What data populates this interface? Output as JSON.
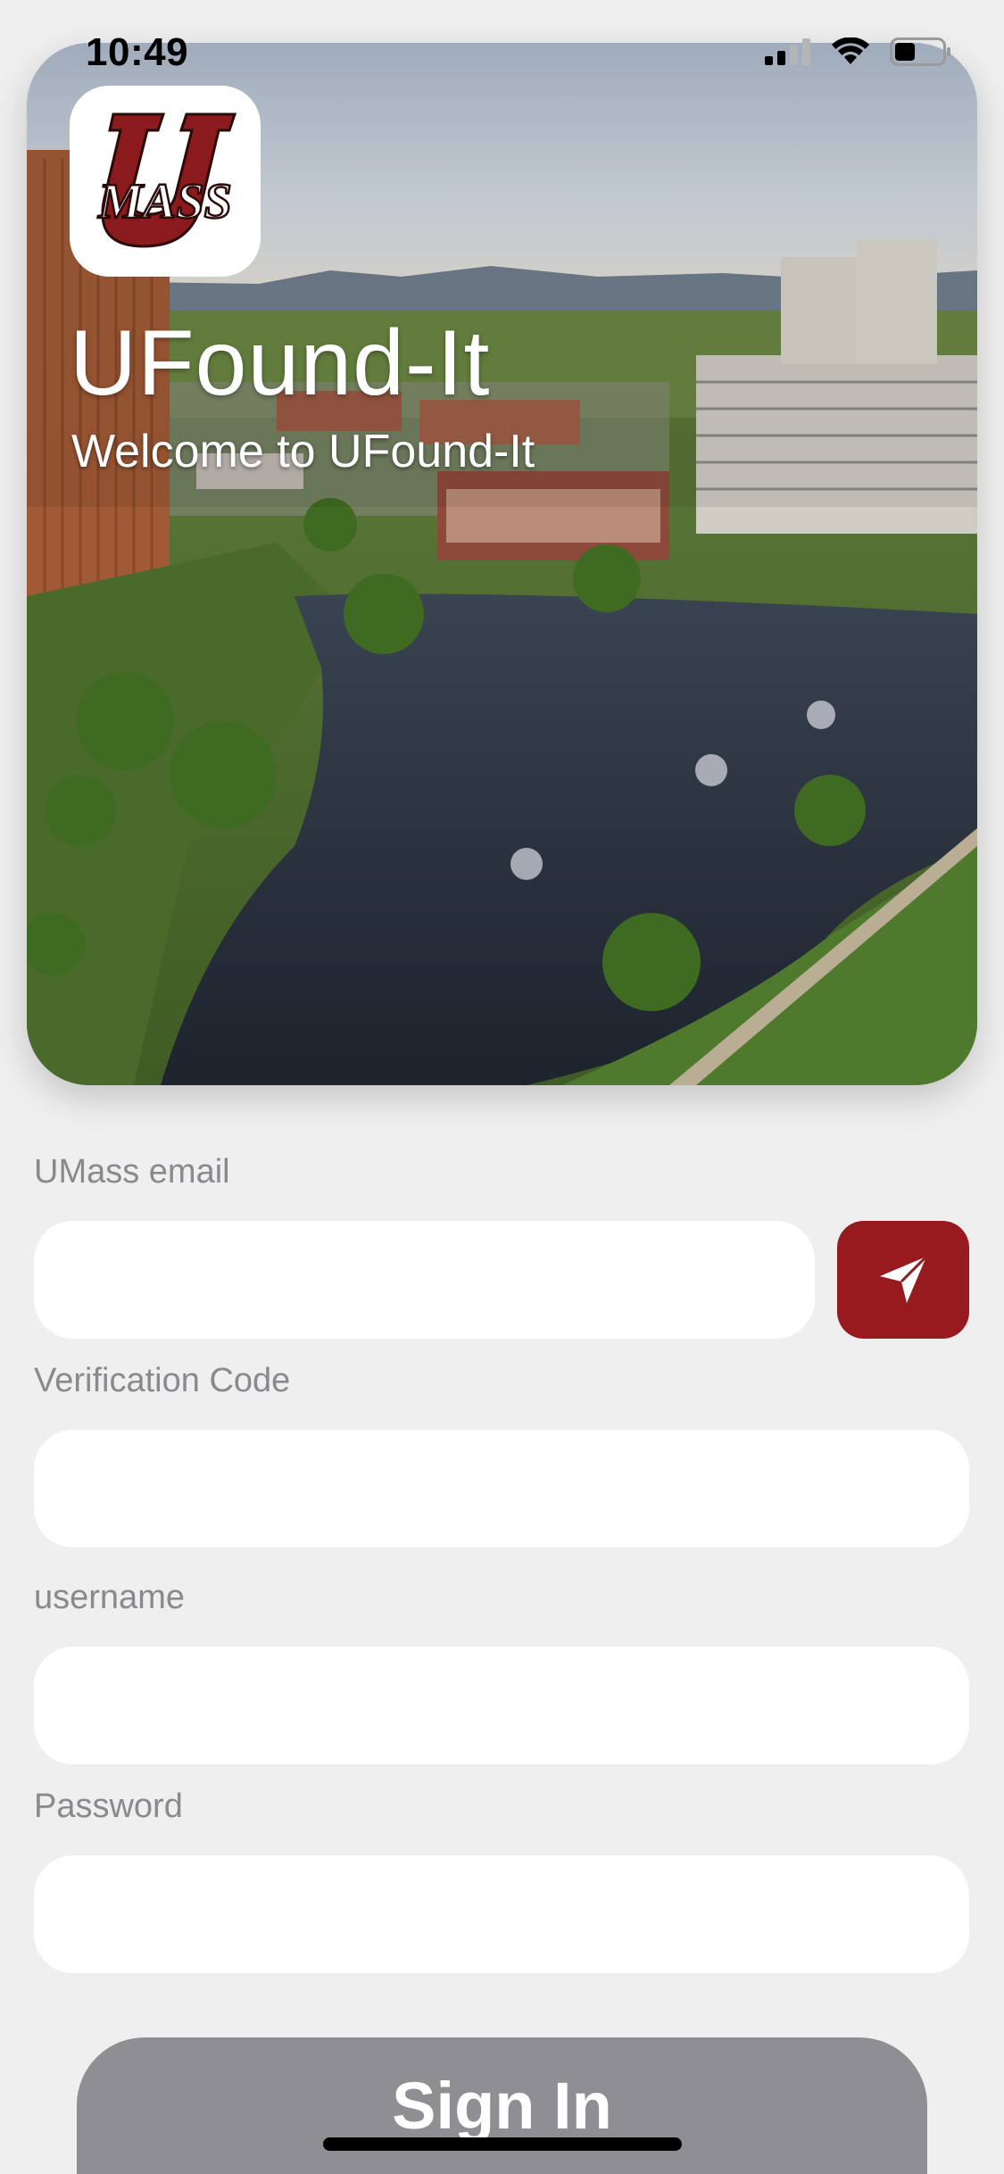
{
  "status_bar": {
    "time": "10:49",
    "icons": [
      "cellular-signal-icon",
      "wifi-icon",
      "battery-icon"
    ]
  },
  "hero": {
    "logo_text": "MASS",
    "logo_icon": "umass-logo",
    "title": "UFound-It",
    "subtitle": "Welcome to UFound-It"
  },
  "form": {
    "email_label": "UMass email",
    "email_value": "",
    "send_icon": "paper-plane-icon",
    "code_label": "Verification Code",
    "code_value": "",
    "username_label": "username",
    "username_value": "",
    "password_label": "Password",
    "password_value": ""
  },
  "actions": {
    "sign_in_label": "Sign In"
  },
  "colors": {
    "accent": "#971b1e",
    "background": "#efefef",
    "button_disabled": "#8e8e93",
    "label_gray": "#8a8a8e"
  }
}
